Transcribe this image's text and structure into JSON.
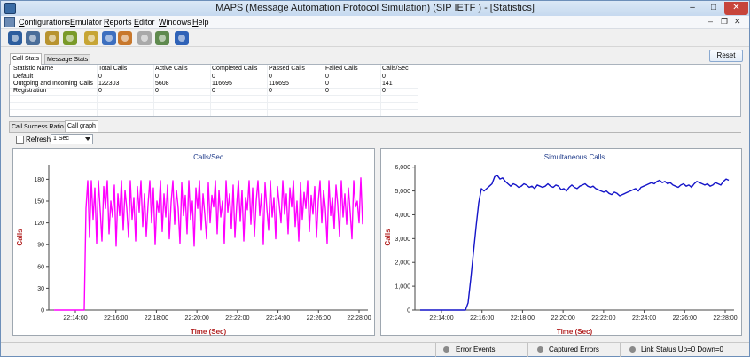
{
  "window": {
    "title": "MAPS (Message Automation Protocol Simulation)  (SIP IETF ) - [Statistics]",
    "minimize": "–",
    "maximize": "□",
    "close": "✕"
  },
  "menu": {
    "items": [
      "Configurations",
      "Emulator",
      "Reports",
      "Editor",
      "Windows",
      "Help"
    ],
    "mdi_controls": [
      "–",
      "❐",
      "✕"
    ]
  },
  "toolbar": {
    "icons": [
      {
        "name": "settings-gear-icon",
        "color": "#2c5d9e"
      },
      {
        "name": "script-editor-icon",
        "color": "#4a6d99"
      },
      {
        "name": "call-flow-icon",
        "color": "#b8932f"
      },
      {
        "name": "run-icon",
        "color": "#7a9a2a"
      },
      {
        "name": "config-icon",
        "color": "#c7a535"
      },
      {
        "name": "profile-icon",
        "color": "#3d6fbf"
      },
      {
        "name": "suitcase-icon",
        "color": "#c8782c"
      },
      {
        "name": "check-icon",
        "color": "#a9a9a9"
      },
      {
        "name": "agent-icon",
        "color": "#5f8a4e"
      },
      {
        "name": "help-icon",
        "color": "#2f62b7"
      }
    ]
  },
  "stats_tabs": [
    "Call Stats",
    "Message Stats"
  ],
  "reset_label": "Reset",
  "table": {
    "headers": [
      "Statistic Name",
      "Total Calls",
      "Active Calls",
      "Completed Calls",
      "Passed Calls",
      "Failed Calls",
      "Calls/Sec"
    ],
    "rows": [
      [
        "Default",
        "0",
        "0",
        "0",
        "0",
        "0",
        "0"
      ],
      [
        "Outgoing and Incoming Calls",
        "122303",
        "5608",
        "116695",
        "116695",
        "0",
        "141"
      ],
      [
        "Registration",
        "0",
        "0",
        "0",
        "0",
        "0",
        "0"
      ]
    ]
  },
  "graph_tabs": [
    "Call Success Ratio",
    "Call graph"
  ],
  "refresh": {
    "label": "Refresh",
    "interval": "1 Sec"
  },
  "chart_data": [
    {
      "type": "line",
      "title": "Calls/Sec",
      "xlabel": "Time (Sec)",
      "ylabel": "Calls",
      "x_ticks": [
        "22:14:00",
        "22:16:00",
        "22:18:00",
        "22:20:00",
        "22:22:00",
        "22:24:00",
        "22:26:00",
        "22:28:00"
      ],
      "y_ticks": [
        "0",
        "30",
        "60",
        "90",
        "120",
        "150",
        "180"
      ],
      "ylim": [
        0,
        200
      ],
      "grid": false,
      "series": [
        {
          "color": "#ff00ff",
          "values": [
            0,
            0,
            0,
            0,
            0,
            0,
            0,
            0,
            0,
            0,
            0,
            0,
            0,
            0,
            0,
            0,
            0,
            0,
            140,
            178,
            100,
            178,
            125,
            168,
            92,
            178,
            138,
            95,
            170,
            140,
            178,
            105,
            150,
            128,
            172,
            88,
            160,
            130,
            178,
            110,
            165,
            140,
            100,
            178,
            125,
            155,
            95,
            170,
            135,
            178,
            115,
            160,
            102,
            145,
            178,
            120,
            168,
            90,
            150,
            135,
            178,
            108,
            160,
            128,
            172,
            98,
            148,
            178,
            118,
            165,
            140,
            92,
            175,
            130,
            158,
            105,
            178,
            125,
            150,
            88,
            168,
            140,
            178,
            110,
            160,
            132,
            98,
            175,
            120,
            158,
            142,
            178,
            105,
            165,
            128,
            150,
            92,
            178,
            135,
            160,
            112,
            172,
            100,
            145,
            178,
            122,
            165,
            95,
            155,
            138,
            178,
            118,
            168,
            102,
            150,
            178,
            130,
            160,
            90,
            175,
            140,
            110,
            178,
            128,
            155,
            98,
            170,
            145,
            120,
            178,
            132,
            160,
            105,
            168,
            142,
            178,
            115,
            150,
            95,
            175,
            125,
            162,
            140,
            178,
            108,
            158,
            132,
            170,
            100,
            150,
            178,
            120,
            165,
            140,
            92,
            178,
            130,
            155,
            112,
            172,
            145,
            102,
            178,
            128,
            160,
            118,
            168,
            135,
            98,
            178,
            142,
            150,
            120,
            182,
            118
          ]
        }
      ]
    },
    {
      "type": "line",
      "title": "Simultaneous Calls",
      "xlabel": "Time (Sec)",
      "ylabel": "Calls",
      "x_ticks": [
        "22:14:00",
        "22:16:00",
        "22:18:00",
        "22:20:00",
        "22:22:00",
        "22:24:00",
        "22:26:00",
        "22:28:00"
      ],
      "y_ticks": [
        "0",
        "1,000",
        "2,000",
        "3,000",
        "4,000",
        "5,000",
        "6,000"
      ],
      "ylim": [
        0,
        6100
      ],
      "grid": false,
      "series": [
        {
          "color": "#1414c8",
          "values": [
            0,
            0,
            0,
            0,
            0,
            0,
            0,
            0,
            0,
            0,
            0,
            0,
            0,
            0,
            0,
            0,
            0,
            0,
            300,
            1300,
            2400,
            3500,
            4500,
            5100,
            5000,
            5100,
            5200,
            5300,
            5600,
            5650,
            5500,
            5550,
            5400,
            5300,
            5200,
            5300,
            5250,
            5150,
            5200,
            5300,
            5250,
            5150,
            5200,
            5100,
            5250,
            5200,
            5150,
            5200,
            5300,
            5200,
            5150,
            5250,
            5200,
            5050,
            5100,
            5000,
            5150,
            5250,
            5150,
            5100,
            5200,
            5250,
            5300,
            5200,
            5150,
            5200,
            5100,
            5050,
            5000,
            4950,
            5000,
            4900,
            4850,
            4950,
            4900,
            4800,
            4850,
            4900,
            4950,
            5000,
            5050,
            5100,
            5000,
            5150,
            5200,
            5250,
            5300,
            5350,
            5300,
            5400,
            5450,
            5350,
            5400,
            5300,
            5350,
            5250,
            5200,
            5150,
            5250,
            5300,
            5200,
            5250,
            5150,
            5300,
            5400,
            5350,
            5300,
            5250,
            5300,
            5200,
            5250,
            5350,
            5300,
            5250,
            5400,
            5500,
            5450
          ]
        }
      ]
    }
  ],
  "status": {
    "error_events": "Error Events",
    "captured_errors": "Captured Errors",
    "link_status": "Link Status Up=0 Down=0"
  }
}
